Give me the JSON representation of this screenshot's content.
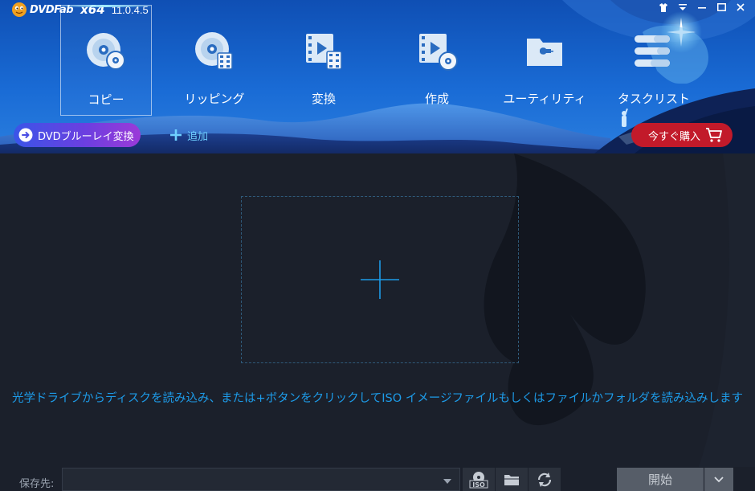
{
  "app": {
    "brand": "DVDFab",
    "arch": "x64",
    "version": "11.0.4.5"
  },
  "window_controls": [
    {
      "name": "skin-icon"
    },
    {
      "name": "menu-icon"
    },
    {
      "name": "minimize-icon"
    },
    {
      "name": "maximize-icon"
    },
    {
      "name": "close-icon"
    }
  ],
  "nav": {
    "items": [
      {
        "label": "コピー",
        "icon": "disc-copy-icon",
        "active": true
      },
      {
        "label": "リッピング",
        "icon": "disc-rip-icon",
        "active": false
      },
      {
        "label": "変換",
        "icon": "film-convert-icon",
        "active": false
      },
      {
        "label": "作成",
        "icon": "film-create-icon",
        "active": false
      },
      {
        "label": "ユーティリティ",
        "icon": "folder-utility-icon",
        "active": false
      },
      {
        "label": "タスクリスト",
        "icon": "task-list-icon",
        "active": false
      }
    ]
  },
  "toolbar": {
    "mode_label": "DVDブルーレイ変換",
    "add_label": "追加",
    "buy_label": "今すぐ購入"
  },
  "main": {
    "hint": "光学ドライブからディスクを読み込み、または+ボタンをクリックしてISO イメージファイルもしくはファイルかフォルダを読み込みします"
  },
  "bottom": {
    "dest_label": "保存先:",
    "dest_value": "",
    "tools": [
      {
        "name": "iso-button",
        "icon": "iso-icon"
      },
      {
        "name": "folder-button",
        "icon": "folder-icon"
      },
      {
        "name": "refresh-button",
        "icon": "refresh-icon"
      }
    ],
    "start_label": "開始"
  },
  "colors": {
    "header_blue": "#1560c8",
    "accent_cyan": "#1d9be8",
    "buy_red": "#c21a2a",
    "pill_start": "#3a55e8",
    "pill_end": "#9b3ad8",
    "main_bg": "#1b202b"
  }
}
